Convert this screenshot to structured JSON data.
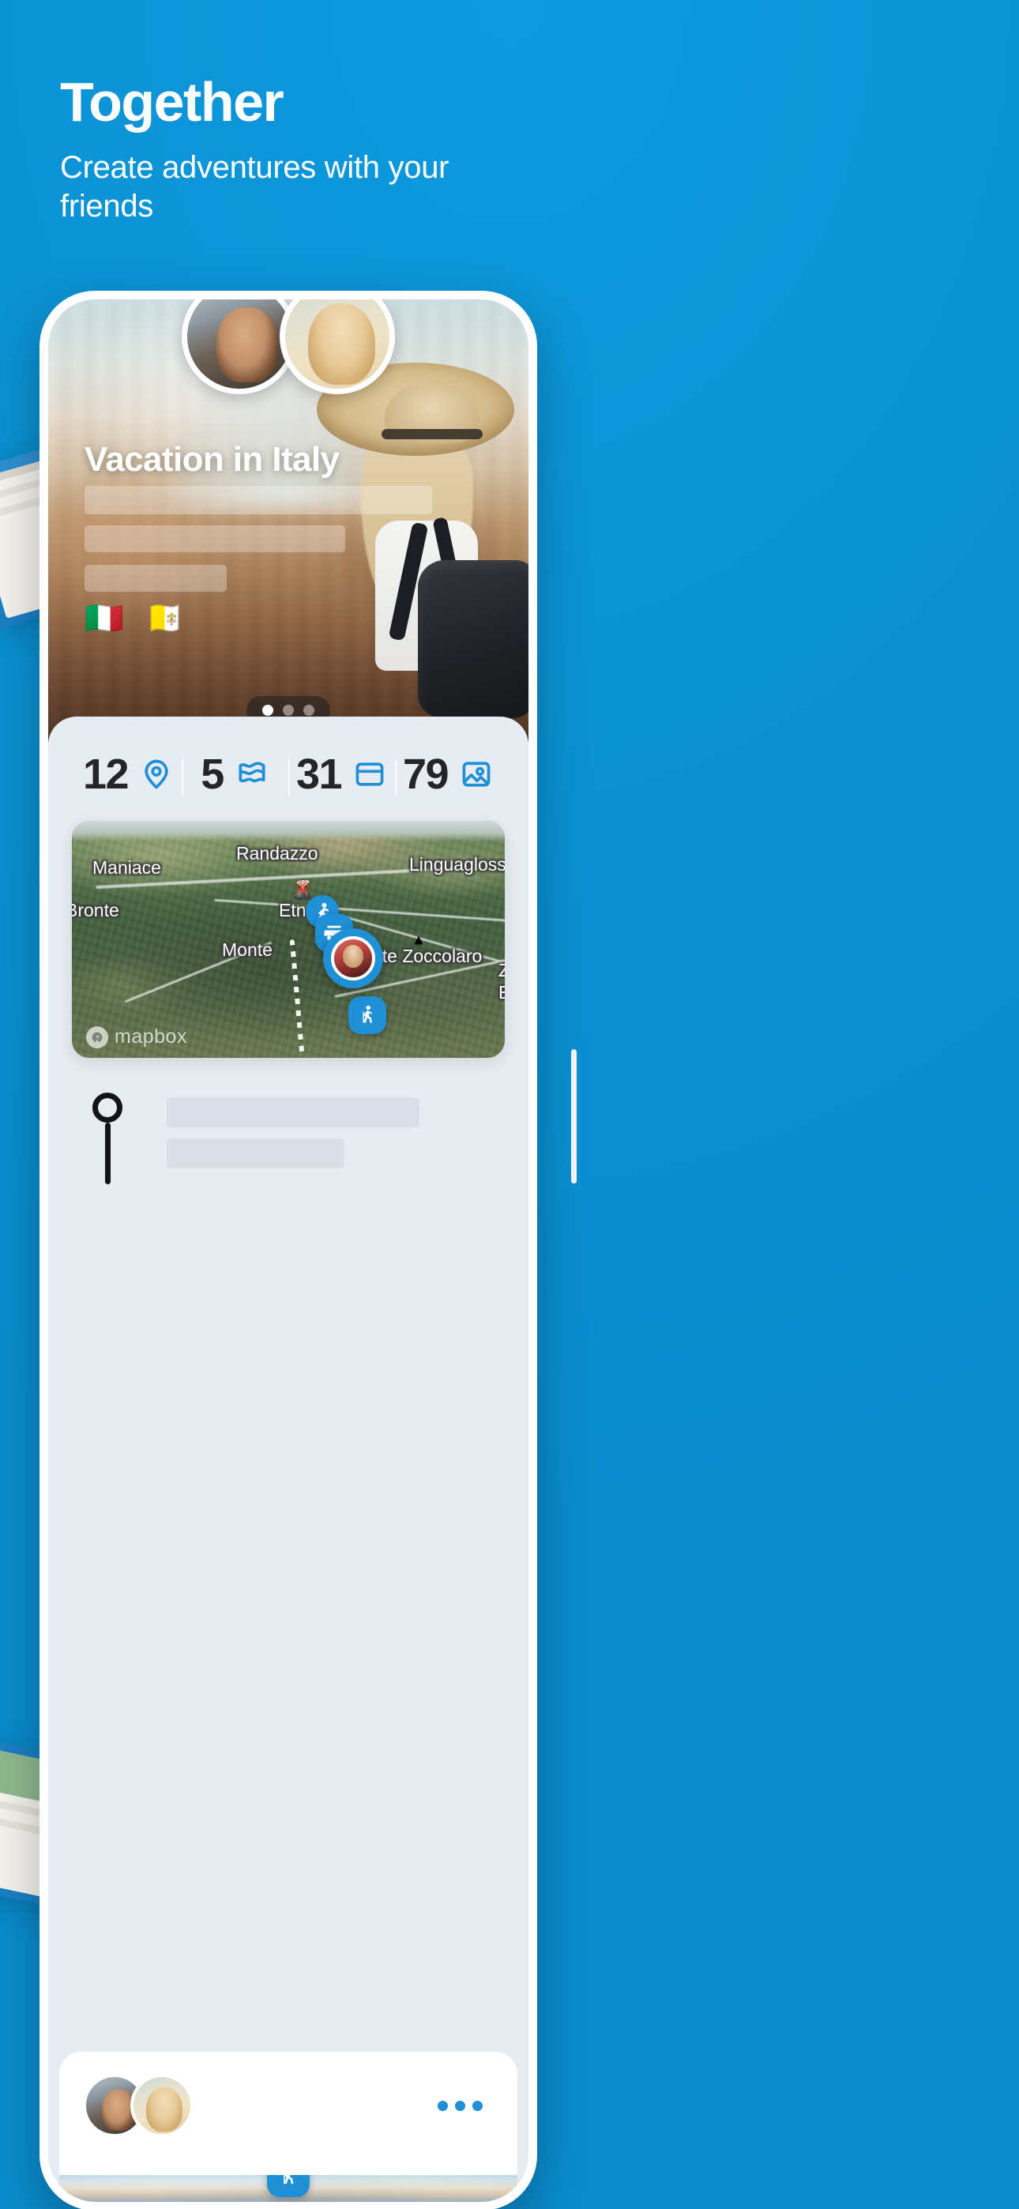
{
  "hero": {
    "title": "Together",
    "subtitle": "Create adventures with your friends"
  },
  "colors": {
    "background": "#0b93d5",
    "accent": "#1f8fd6",
    "text_dark": "#232629",
    "sheet": "#e7ecf2",
    "card": "#ffffff"
  },
  "trip": {
    "title": "Vacation in Italy",
    "flags": "🇮🇹 🇻🇦",
    "carousel": {
      "total_dots": 3,
      "active_index": 0
    }
  },
  "stats": [
    {
      "value": "12",
      "icon": "location-pin-icon",
      "name": "places"
    },
    {
      "value": "5",
      "icon": "flag-icon",
      "name": "countries"
    },
    {
      "value": "31",
      "icon": "card-icon",
      "name": "cards"
    },
    {
      "value": "79",
      "icon": "photo-icon",
      "name": "photos"
    }
  ],
  "map": {
    "attribution": "mapbox",
    "labels": [
      {
        "text": "Maniace"
      },
      {
        "text": "Randazzo"
      },
      {
        "text": "Bronte"
      },
      {
        "text": "Linguaglossa"
      },
      {
        "text": "Etna"
      },
      {
        "text": "Monte"
      },
      {
        "text": "Monte Zoccolaro"
      },
      {
        "text": "Za"
      },
      {
        "text": "Eu"
      }
    ],
    "markers": [
      {
        "icon": "hiker-icon"
      },
      {
        "icon": "camper-van-icon"
      },
      {
        "icon": "walking-icon"
      },
      {
        "icon": "car-icon"
      },
      {
        "icon": "photo-avatar-marker"
      }
    ]
  },
  "timeline": {
    "pin_icon": "timeline-pin-icon",
    "placeholder_lines": 2
  },
  "bottom_card": {
    "avatars": 2,
    "more_label": "•••",
    "chip_icon": "walking-icon"
  }
}
